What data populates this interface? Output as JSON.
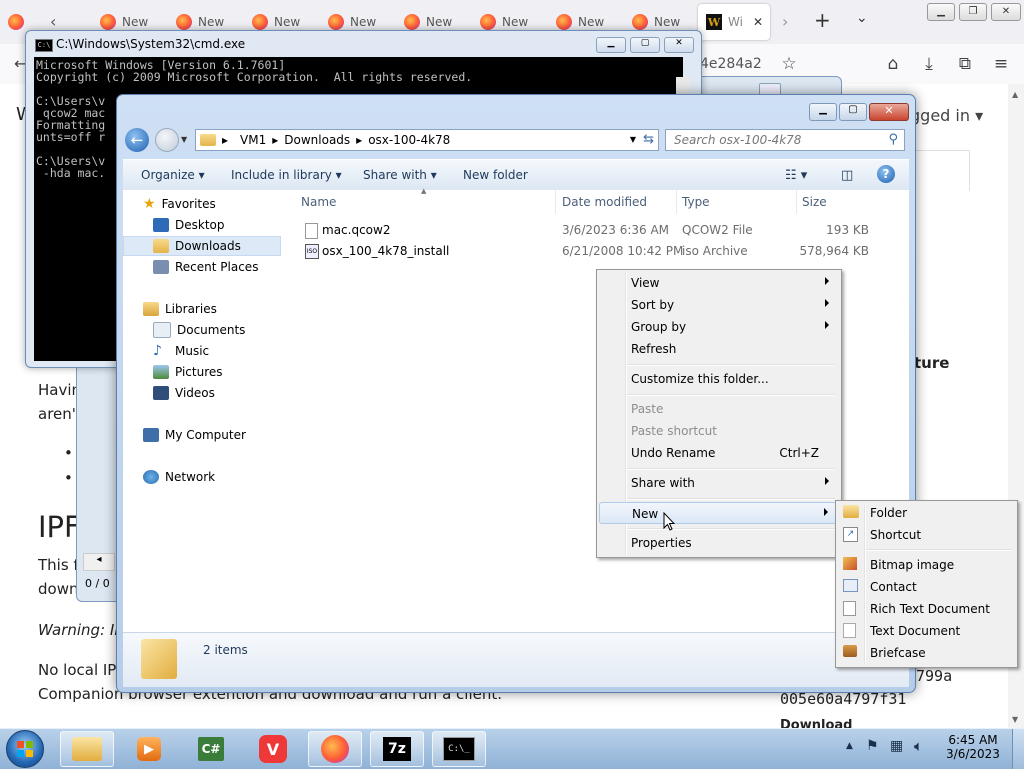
{
  "browser": {
    "tabs": [
      {
        "label": "New"
      },
      {
        "label": "New"
      },
      {
        "label": "New"
      },
      {
        "label": "New"
      },
      {
        "label": "New"
      },
      {
        "label": "New"
      },
      {
        "label": "New"
      },
      {
        "label": "New"
      }
    ],
    "active_tab": {
      "label": "Wi"
    },
    "url_fragment": "4e284a2",
    "login_text": "gged in",
    "content": {
      "side_heading": "ture",
      "para1_a": "Havin",
      "para1_b": "aren't",
      "heading": "IPF",
      "para2_a": "This f",
      "para2_b": "down",
      "warning": "Warning: IP",
      "para3_a": "No local IP",
      "para3_b": "Companion browser extention and download and run a client.",
      "hash_a": "799a",
      "hash_b": "005e60a4797f31",
      "status_counter": "0 / 0"
    }
  },
  "cmd": {
    "title": "C:\\Windows\\System32\\cmd.exe",
    "lines": [
      "Microsoft Windows [Version 6.1.7601]",
      "Copyright (c) 2009 Microsoft Corporation.  All rights reserved.",
      "",
      "C:\\Users\\v",
      " qcow2 mac",
      "Formatting",
      "unts=off r",
      "",
      "C:\\Users\\v",
      " -hda mac."
    ]
  },
  "explorer": {
    "breadcrumbs": [
      "VM1",
      "Downloads",
      "osx-100-4k78"
    ],
    "search_placeholder": "Search osx-100-4k78",
    "toolbar": {
      "organize": "Organize",
      "include": "Include in library",
      "share": "Share with",
      "new_folder": "New folder"
    },
    "nav": {
      "favorites": "Favorites",
      "desktop": "Desktop",
      "downloads": "Downloads",
      "recent": "Recent Places",
      "libraries": "Libraries",
      "documents": "Documents",
      "music": "Music",
      "pictures": "Pictures",
      "videos": "Videos",
      "computer": "My Computer",
      "network": "Network"
    },
    "columns": {
      "name": "Name",
      "date": "Date modified",
      "type": "Type",
      "size": "Size"
    },
    "files": [
      {
        "name": "mac.qcow2",
        "date": "3/6/2023 6:36 AM",
        "type": "QCOW2 File",
        "size": "193 KB"
      },
      {
        "name": "osx_100_4k78_install",
        "date": "6/21/2008 10:42 PM",
        "type": "iso Archive",
        "size": "578,964 KB"
      }
    ],
    "status": "2 items"
  },
  "context_menu": {
    "view": "View",
    "sort_by": "Sort by",
    "group_by": "Group by",
    "refresh": "Refresh",
    "customize": "Customize this folder...",
    "paste": "Paste",
    "paste_shortcut": "Paste shortcut",
    "undo": "Undo Rename",
    "undo_shortcut": "Ctrl+Z",
    "share": "Share with",
    "new": "New",
    "properties": "Properties"
  },
  "new_submenu": {
    "folder": "Folder",
    "shortcut": "Shortcut",
    "bitmap": "Bitmap image",
    "contact": "Contact",
    "rtf": "Rich Text Document",
    "txt": "Text Document",
    "briefcase": "Briefcase"
  },
  "taskbar": {
    "time": "6:45 AM",
    "date": "3/6/2023"
  }
}
